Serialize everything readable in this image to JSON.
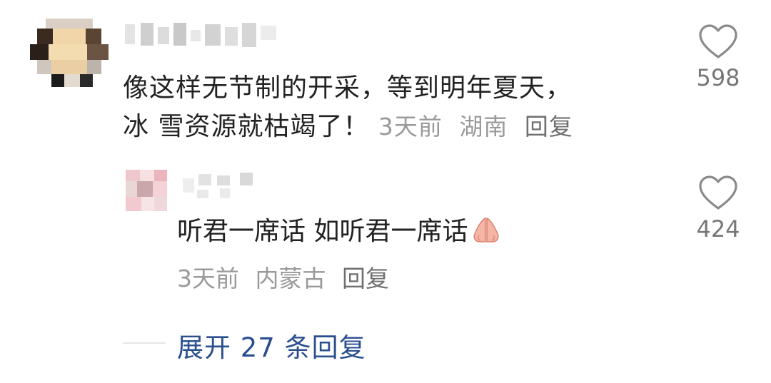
{
  "comment": {
    "like_count": "598",
    "text_line1": "像这样无节制的开采，等到明年夏天，",
    "text_line2": "冰 雪资源就枯竭了！",
    "time": "3天前",
    "location": "湖南",
    "reply_label": "回复"
  },
  "reply": {
    "like_count": "424",
    "text": "听君一席话 如听君一席话",
    "emoji_icon": "folded-hands-icon",
    "time": "3天前",
    "location": "内蒙古",
    "reply_label": "回复"
  },
  "expand": {
    "label": "展开 27 条回复"
  },
  "colors": {
    "link_blue": "#2a4f8f",
    "meta_gray": "#9a9a9a"
  }
}
